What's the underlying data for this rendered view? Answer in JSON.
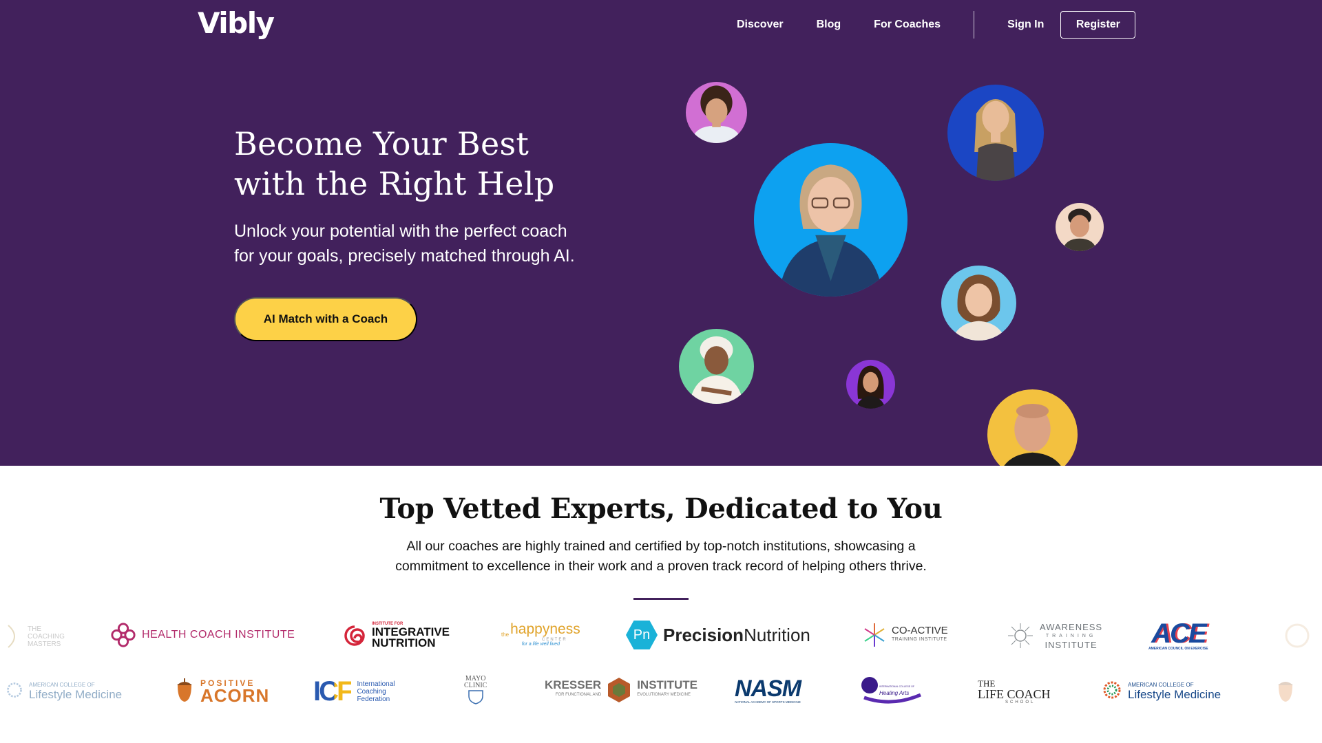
{
  "header": {
    "logo": "Vibly",
    "nav": [
      "Discover",
      "Blog",
      "For Coaches"
    ],
    "sign_in": "Sign In",
    "register": "Register"
  },
  "hero": {
    "title_line1": "Become Your Best",
    "title_line2": "with the Right Help",
    "subtitle_line1": "Unlock your potential with the perfect coach",
    "subtitle_line2": "for your goals, precisely matched through AI.",
    "cta": "AI Match with a Coach"
  },
  "experts": {
    "title": "Top Vetted Experts, Dedicated to You",
    "subtitle_line1": "All our coaches are highly trained and certified by top-notch institutions, showcasing a",
    "subtitle_line2": "commitment to excellence in their work and a proven track record of helping others thrive."
  },
  "institutions_row1": [
    {
      "name": "THE COACHING MASTERS"
    },
    {
      "name": "HEALTH COACH INSTITUTE"
    },
    {
      "pre": "INSTITUTE FOR",
      "l1": "INTEGRATIVE",
      "l2": "NUTRITION"
    },
    {
      "pre": "the",
      "name": "happyness",
      "post": "CENTER",
      "tag": "for a life well lived"
    },
    {
      "badge": "Pn",
      "name1": "Precision",
      "name2": "Nutrition"
    },
    {
      "name": "CO-ACTIVE",
      "sub": "TRAINING INSTITUTE"
    },
    {
      "l1": "AWARENESS",
      "l2": "TRAINING",
      "l3": "INSTITUTE"
    },
    {
      "name": "ACE",
      "sub": "AMERICAN COUNCIL ON EXERCISE"
    }
  ],
  "institutions_row2": [
    {
      "l1": "AMERICAN COLLEGE OF",
      "l2": "Lifestyle Medicine"
    },
    {
      "l1": "POSITIVE",
      "l2": "ACORN"
    },
    {
      "name": "ICF",
      "l1": "International",
      "l2": "Coaching",
      "l3": "Federation"
    },
    {
      "l1": "MAYO",
      "l2": "CLINIC"
    },
    {
      "name1": "KRESSER",
      "name2": "INSTITUTE",
      "sub1": "FOR FUNCTIONAL AND",
      "sub2": "EVOLUTIONARY MEDICINE"
    },
    {
      "name": "NASM",
      "sub": "NATIONAL ACADEMY OF SPORTS MEDICINE"
    },
    {
      "l1": "INTERNATIONAL COLLEGE OF",
      "l2": "Healing Arts"
    },
    {
      "l1": "THE",
      "l2": "LIFE COACH",
      "l3": "SCHOOL"
    },
    {
      "l1": "AMERICAN COLLEGE OF",
      "l2": "Lifestyle Medicine"
    }
  ],
  "colors": {
    "hero_bg": "#42215c",
    "cta_bg": "#fdd147",
    "accent_rule": "#42215c"
  }
}
